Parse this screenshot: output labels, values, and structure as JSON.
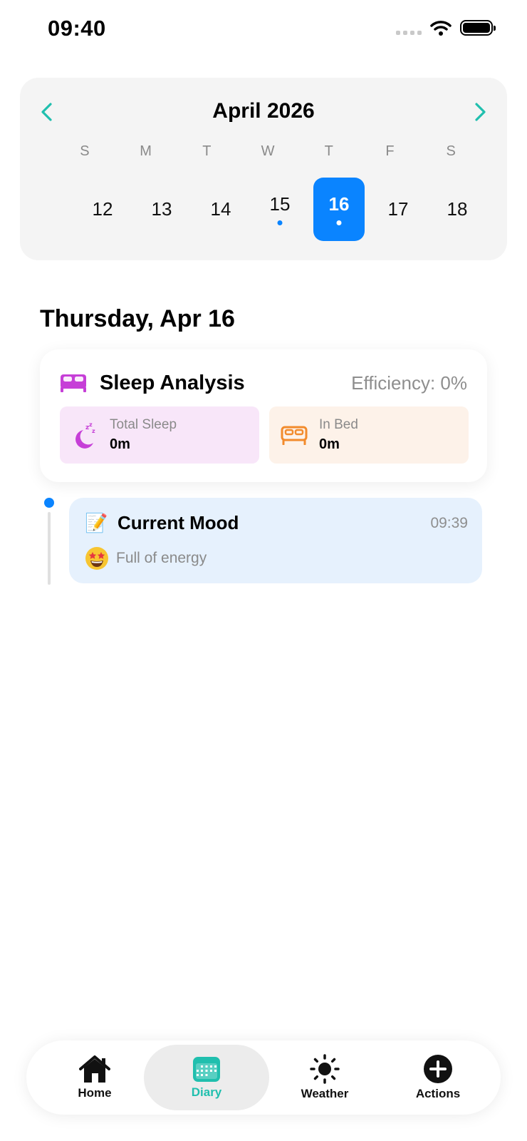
{
  "status_bar": {
    "time": "09:40"
  },
  "calendar": {
    "month_title": "April 2026",
    "weekdays": [
      "S",
      "M",
      "T",
      "W",
      "T",
      "F",
      "S"
    ],
    "days": [
      {
        "number": "12"
      },
      {
        "number": "13"
      },
      {
        "number": "14"
      },
      {
        "number": "15",
        "has_entry": true
      },
      {
        "number": "16",
        "has_entry": true,
        "selected": true
      },
      {
        "number": "17"
      },
      {
        "number": "18"
      }
    ]
  },
  "date_heading": "Thursday, Apr 16",
  "sleep_analysis": {
    "title": "Sleep Analysis",
    "efficiency": "Efficiency: 0%",
    "total_sleep_label": "Total Sleep",
    "total_sleep_value": "0m",
    "in_bed_label": "In Bed",
    "in_bed_value": "0m"
  },
  "mood_entry": {
    "icon": "📝",
    "title": "Current Mood",
    "time": "09:39",
    "mood_emoji": "star-struck-face",
    "mood_text": "Full of energy"
  },
  "tabs": [
    {
      "label": "Home",
      "icon": "house-icon"
    },
    {
      "label": "Diary",
      "icon": "calendar-icon",
      "active": true
    },
    {
      "label": "Weather",
      "icon": "sun-icon"
    },
    {
      "label": "Actions",
      "icon": "plus-circle-icon"
    }
  ],
  "colors": {
    "accent_blue": "#0a84ff",
    "accent_teal": "#20bfae",
    "sleep_purple": "#c63fd7",
    "bed_orange": "#f28b2c"
  }
}
